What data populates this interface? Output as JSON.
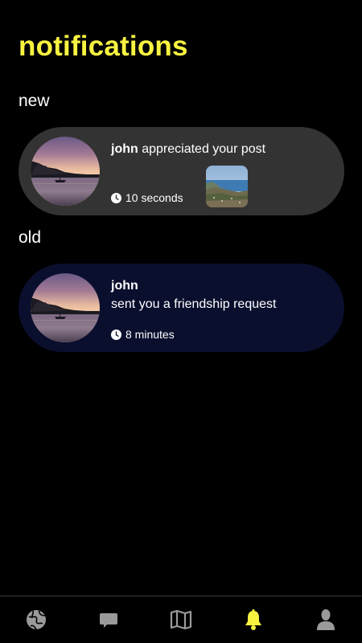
{
  "header": {
    "title": "notifications"
  },
  "sections": {
    "new_label": "new",
    "old_label": "old"
  },
  "notifications": {
    "new": [
      {
        "user": "john",
        "action": "appreciated your post",
        "time": "10 seconds",
        "has_post_thumbnail": true
      }
    ],
    "old": [
      {
        "user": "john",
        "action": "sent you a friendship request",
        "time": "8 minutes",
        "has_post_thumbnail": false
      }
    ]
  },
  "tabbar": {
    "items": [
      {
        "icon": "globe-icon",
        "active": false
      },
      {
        "icon": "chat-icon",
        "active": false
      },
      {
        "icon": "map-icon",
        "active": false
      },
      {
        "icon": "bell-icon",
        "active": true
      },
      {
        "icon": "profile-icon",
        "active": false
      }
    ]
  },
  "colors": {
    "accent": "#f7f340",
    "background": "#000000",
    "new_card": "#333333",
    "old_card": "#0a0f2e",
    "inactive_icon": "#9a9a9a"
  }
}
